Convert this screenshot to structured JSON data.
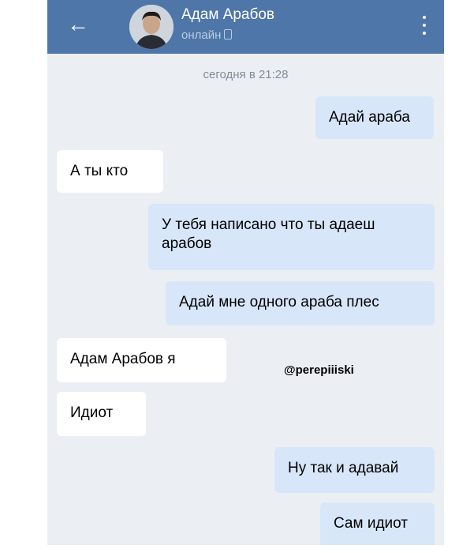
{
  "header": {
    "back_icon": "arrow-left-icon",
    "name": "Адам Арабов",
    "status": "онлайн",
    "status_icon": "mobile-device-icon",
    "menu_icon": "more-vertical-icon",
    "bg_color": "#4f76a8"
  },
  "date_divider": "сегодня в 21:28",
  "messages": [
    {
      "from": "me",
      "text": "Адай араба"
    },
    {
      "from": "them",
      "text": "А ты кто"
    },
    {
      "from": "me",
      "text": "У тебя написано что ты адаеш арабов"
    },
    {
      "from": "me",
      "text": "Адай мне одного араба плес"
    },
    {
      "from": "them",
      "text": "Адам Арабов я"
    },
    {
      "from": "them",
      "text": "Идиот"
    },
    {
      "from": "me",
      "text": "Ну так и адавай"
    },
    {
      "from": "me",
      "text": "Сам идиот"
    }
  ],
  "watermark": "@perepiiiski",
  "colors": {
    "outgoing_bubble": "#d7e6f9",
    "incoming_bubble": "#ffffff",
    "chat_background": "#ebeff4"
  }
}
